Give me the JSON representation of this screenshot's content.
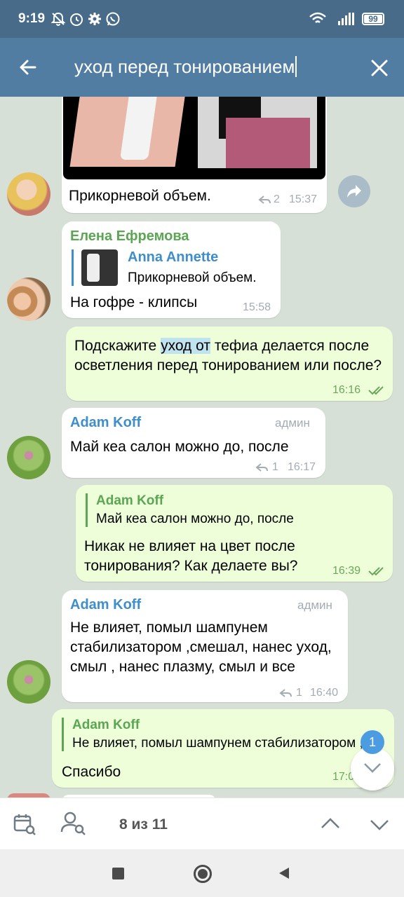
{
  "status": {
    "time": "9:19",
    "battery": "99"
  },
  "search": {
    "query": "уход перед тонированием"
  },
  "colors": {
    "header": "#527da3",
    "accent_green": "#5aa653",
    "link_blue": "#3e8ec9"
  },
  "messages": [
    {
      "caption": "Прикорневой объем.",
      "replies": "2",
      "time": "15:37"
    },
    {
      "sender": "Елена Ефремова",
      "quote_name": "Anna Annette",
      "quote_text": "Прикорневой объем.",
      "text": "На гофре - клипсы",
      "time": "15:58"
    },
    {
      "text_before": "Подскажите ",
      "highlight": "уход от",
      "text_after": " тефиа делается после осветления перед тонированием или после?",
      "time": "16:16"
    },
    {
      "sender": "Adam Koff",
      "role": "админ",
      "text": "Май кеа салон можно до, после",
      "replies": "1",
      "time": "16:17"
    },
    {
      "quote_name": "Adam Koff",
      "quote_text": "Май кеа салон можно до, после",
      "text": "Никак не влияет на цвет после тонирования? Как делаете вы?",
      "time": "16:39"
    },
    {
      "sender": "Adam Koff",
      "role": "админ",
      "text": "Не влияет, помыл шампунем стабилизатором ,смешал,  нанес уход, смыл , нанес плазму, смыл и все",
      "replies": "1",
      "time": "16:40"
    },
    {
      "quote_name": "Adam Koff",
      "quote_text": "Не влияет, помыл шампунем стабилизатором ,смешал,  нанес уход, смыл , нанес плазму, смыл и все",
      "text": "Спасибо",
      "time": "17:0"
    }
  ],
  "unread_badge": "1",
  "bottom": {
    "counter": "8 из 11"
  }
}
